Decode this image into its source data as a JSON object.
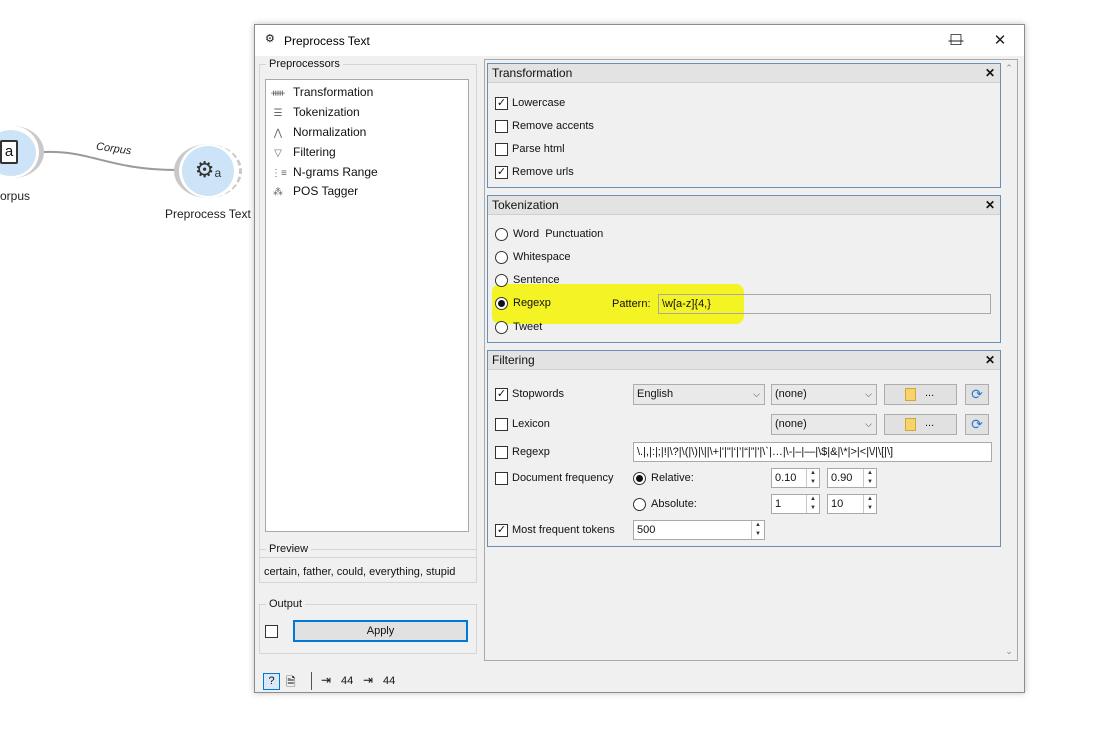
{
  "canvas": {
    "corpus_label": "orpus",
    "corpus_icon_letter": "a",
    "link_label": "Corpus",
    "preprocess_label": "Preprocess Text"
  },
  "window": {
    "title": "Preprocess Text",
    "minimize": "—",
    "maximize": "☐",
    "close": "✕"
  },
  "preprocessors": {
    "legend": "Preprocessors",
    "items": [
      {
        "label": "Transformation",
        "icon": "transformation-icon"
      },
      {
        "label": "Tokenization",
        "icon": "tokenization-icon"
      },
      {
        "label": "Normalization",
        "icon": "normalization-icon"
      },
      {
        "label": "Filtering",
        "icon": "filter-icon"
      },
      {
        "label": "N-grams Range",
        "icon": "ngrams-icon"
      },
      {
        "label": "POS Tagger",
        "icon": "pos-tagger-icon"
      }
    ]
  },
  "preview": {
    "legend": "Preview",
    "text": "certain, father, could, everything, stupid"
  },
  "output": {
    "legend": "Output",
    "apply_label": "Apply",
    "auto_apply_checked": false
  },
  "transformation": {
    "title": "Transformation",
    "options": [
      {
        "label": "Lowercase",
        "checked": true
      },
      {
        "label": "Remove accents",
        "checked": false
      },
      {
        "label": "Parse html",
        "checked": false
      },
      {
        "label": "Remove urls",
        "checked": true
      }
    ]
  },
  "tokenization": {
    "title": "Tokenization",
    "options": [
      {
        "label": "Word  Punctuation",
        "selected": false
      },
      {
        "label": "Whitespace",
        "selected": false
      },
      {
        "label": "Sentence",
        "selected": false
      },
      {
        "label": "Regexp",
        "selected": true
      },
      {
        "label": "Tweet",
        "selected": false
      }
    ],
    "pattern_label": "Pattern:",
    "pattern_value": "\\w[a-z]{4,}"
  },
  "filtering": {
    "title": "Filtering",
    "stopwords": {
      "label": "Stopwords",
      "checked": true,
      "language": "English",
      "file": "(none)",
      "browse": "..."
    },
    "lexicon": {
      "label": "Lexicon",
      "checked": false,
      "file": "(none)",
      "browse": "..."
    },
    "regexp": {
      "label": "Regexp",
      "checked": false,
      "value": "\\.|,|:|;|!|\\?|\\(|\\)|\\||\\+|'|\"|‘|’|“|”|'|\\`|…|\\-|–|—|\\$|&|\\*|>|<|\\/|\\[|\\]"
    },
    "docfreq": {
      "label": "Document frequency",
      "checked": false,
      "relative_label": "Relative:",
      "relative_selected": true,
      "rel_min": "0.10",
      "rel_max": "0.90",
      "absolute_label": "Absolute:",
      "abs_min": "1",
      "abs_max": "10"
    },
    "most_frequent": {
      "label": "Most frequent tokens",
      "checked": true,
      "value": "500"
    }
  },
  "statusbar": {
    "input_count": "44",
    "output_count": "44"
  },
  "colors": {
    "highlight": "#f5f500",
    "focus_border": "#0078d7",
    "group_border": "#6a8fb4"
  }
}
